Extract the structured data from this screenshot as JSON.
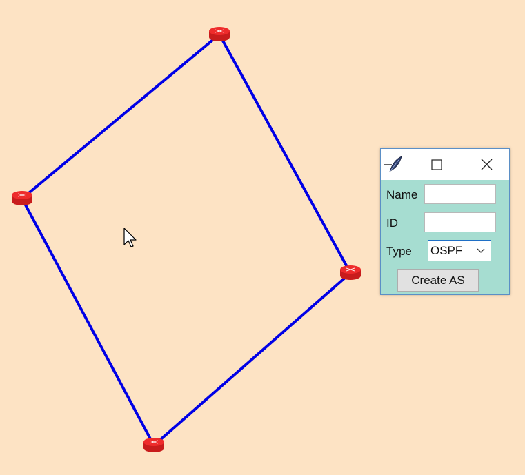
{
  "canvas": {
    "background": "#fde3c4",
    "link_color": "#0000e6",
    "router_color": "#ee2b2b",
    "node_icon": "router-icon",
    "cursor_icon": "mouse-pointer-icon"
  },
  "dialog": {
    "window_icon": "feather-icon",
    "maximize_icon": "maximize-icon",
    "close_icon": "close-icon",
    "name_label": "Name",
    "name_value": "",
    "id_label": "ID",
    "id_value": "",
    "type_label": "Type",
    "type_value": "OSPF",
    "create_button_label": "Create AS",
    "background": "#a6ddd1"
  }
}
